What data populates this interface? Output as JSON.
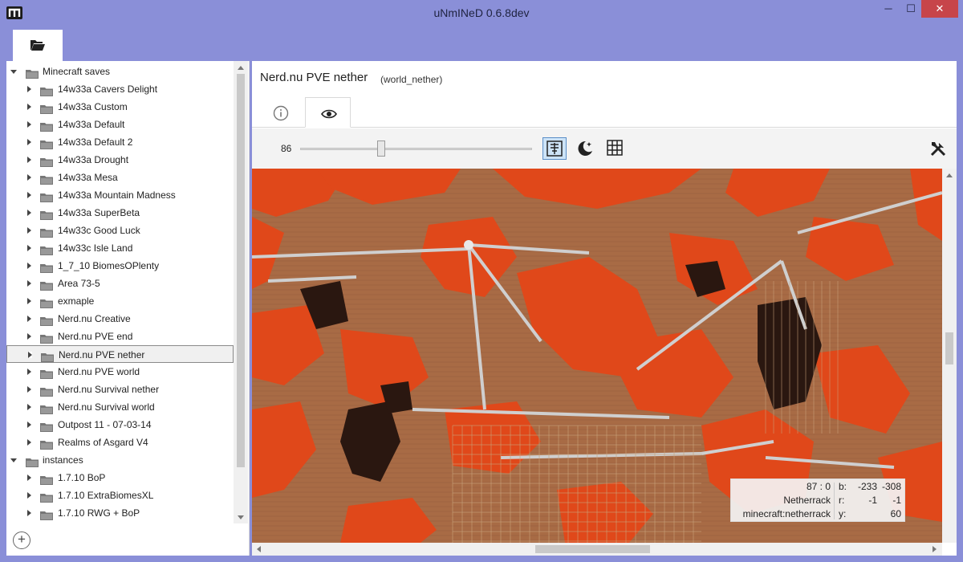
{
  "window": {
    "title": "uNmINeD 0.6.8dev",
    "minimize_glyph": "─",
    "maximize_glyph": "☐",
    "close_glyph": "✕",
    "accent_color": "#8a8fd8",
    "close_color": "#c7454a"
  },
  "toolbar": {
    "open_icon": "open-folder-icon"
  },
  "tree": {
    "groups": [
      {
        "label": "Minecraft saves",
        "expanded": true,
        "items": [
          "14w33a Cavers Delight",
          "14w33a Custom",
          "14w33a Default",
          "14w33a Default 2",
          "14w33a Drought",
          "14w33a Mesa",
          "14w33a Mountain Madness",
          "14w33a SuperBeta",
          "14w33c Good Luck",
          "14w33c Isle Land",
          "1_7_10 BiomesOPlenty",
          "Area 73-5",
          "exmaple",
          "Nerd.nu Creative",
          "Nerd.nu PVE end",
          "Nerd.nu PVE nether",
          "Nerd.nu PVE world",
          "Nerd.nu Survival nether",
          "Nerd.nu Survival world",
          "Outpost 11 - 07-03-14",
          "Realms of Asgard V4"
        ]
      },
      {
        "label": "instances",
        "expanded": true,
        "items": [
          "1.7.10 BoP",
          "1.7.10 ExtraBiomesXL",
          "1.7.10 RWG + BoP"
        ]
      }
    ],
    "selected": "Nerd.nu PVE nether",
    "add_glyph": "+"
  },
  "world": {
    "name": "Nerd.nu PVE nether",
    "folder": "(world_nether)"
  },
  "tabs": [
    {
      "name": "info",
      "icon": "info-icon"
    },
    {
      "name": "view",
      "icon": "eye-icon",
      "active": true
    }
  ],
  "view_controls": {
    "zoom_value": "86",
    "slider_fraction": 0.35,
    "buttons": [
      {
        "icon": "depth-layer-icon",
        "active": true
      },
      {
        "icon": "night-mode-icon",
        "active": false
      },
      {
        "icon": "grid-icon",
        "active": false
      }
    ],
    "tools_icon": "tools-icon"
  },
  "map_colors": {
    "lava": "#e0481a",
    "netherrack": "#a86b45",
    "cave": "#2a1710",
    "rail": "#cfcfcf"
  },
  "block_info": {
    "height": "87 : 0",
    "block_name": "Netherrack",
    "block_id": "minecraft:netherrack",
    "b_label": "b:",
    "b_x": "-233",
    "b_z": "-308",
    "r_label": "r:",
    "r_x": "-1",
    "r_z": "-1",
    "y_label": "y:",
    "y_val": "60"
  }
}
